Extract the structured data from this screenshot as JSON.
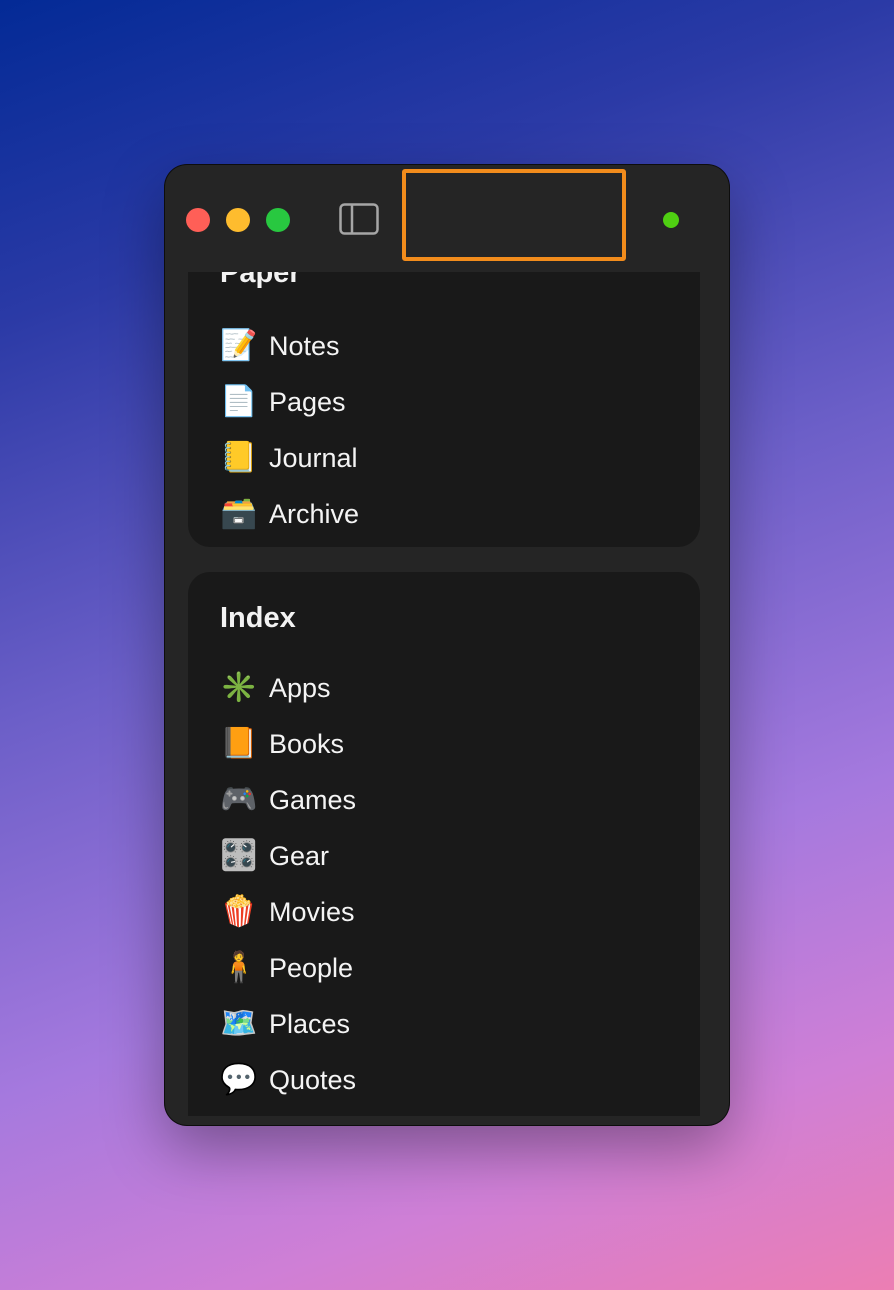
{
  "window": {
    "colors": {
      "close": "#ff5f57",
      "minimize": "#febc2e",
      "maximize": "#28c840",
      "status_dot": "#4fcf12",
      "highlight": "#f28c1c"
    }
  },
  "sections": {
    "paper": {
      "title": "Paper",
      "items": [
        {
          "icon": "📝",
          "icon_name": "memo-icon",
          "label": "Notes"
        },
        {
          "icon": "📄",
          "icon_name": "page-icon",
          "label": "Pages"
        },
        {
          "icon": "📒",
          "icon_name": "ledger-icon",
          "label": "Journal"
        },
        {
          "icon": "🗃️",
          "icon_name": "card-file-box-icon",
          "label": "Archive"
        }
      ]
    },
    "index": {
      "title": "Index",
      "items": [
        {
          "icon": "✳️",
          "icon_name": "sparkle-icon",
          "label": "Apps"
        },
        {
          "icon": "📙",
          "icon_name": "orange-book-icon",
          "label": "Books"
        },
        {
          "icon": "🎮",
          "icon_name": "game-controller-icon",
          "label": "Games"
        },
        {
          "icon": "🎛️",
          "icon_name": "control-knobs-icon",
          "label": "Gear"
        },
        {
          "icon": "🍿",
          "icon_name": "popcorn-icon",
          "label": "Movies"
        },
        {
          "icon": "🧍",
          "icon_name": "person-standing-icon",
          "label": "People"
        },
        {
          "icon": "🗺️",
          "icon_name": "world-map-icon",
          "label": "Places"
        },
        {
          "icon": "💬",
          "icon_name": "speech-bubble-icon",
          "label": "Quotes"
        },
        {
          "icon": "📦",
          "icon_name": "package-icon",
          "label": ""
        }
      ]
    }
  }
}
